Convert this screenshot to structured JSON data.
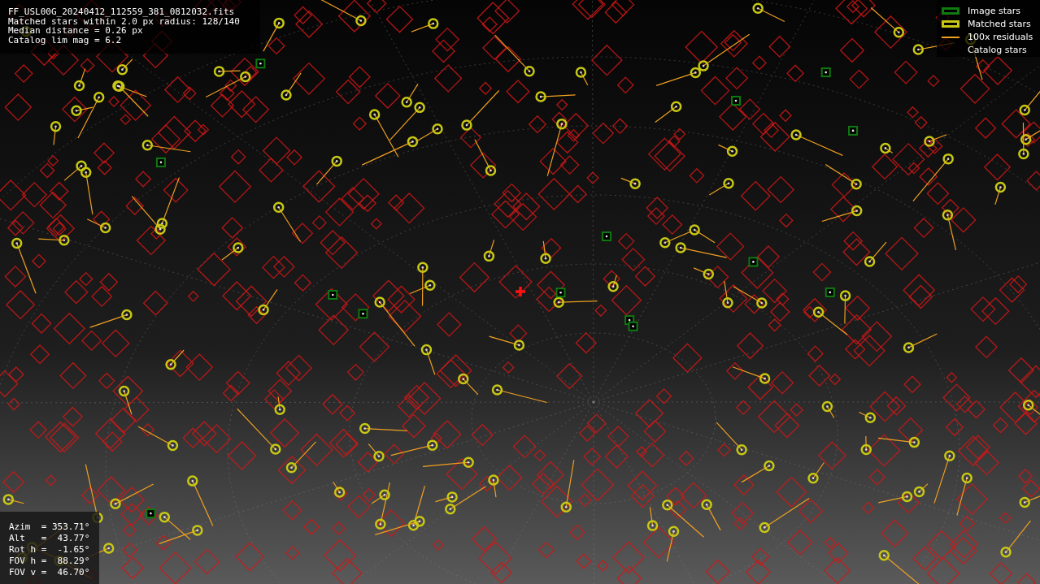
{
  "info": {
    "lines": [
      "FF_USL00G_20240412_112559_381_0812032.fits",
      "Matched stars within 2.0 px radius: 128/140",
      "Median distance = 0.26 px",
      "Catalog lim mag = 6.2"
    ]
  },
  "legend": [
    {
      "kind": "image",
      "label": "Image stars",
      "color": "#0f7a0f"
    },
    {
      "kind": "matched",
      "label": "Matched stars",
      "color": "#c8c814"
    },
    {
      "kind": "residual",
      "label": "100x residuals",
      "color": "#f0a020"
    },
    {
      "kind": "catalog",
      "label": "Catalog stars"
    }
  ],
  "pointing": {
    "lines": [
      "Azim  = 353.71°",
      "Alt   =  43.77°",
      "Rot h =  -1.65°",
      "FOV h =  88.29°",
      "FOV v =  46.70°"
    ]
  }
}
